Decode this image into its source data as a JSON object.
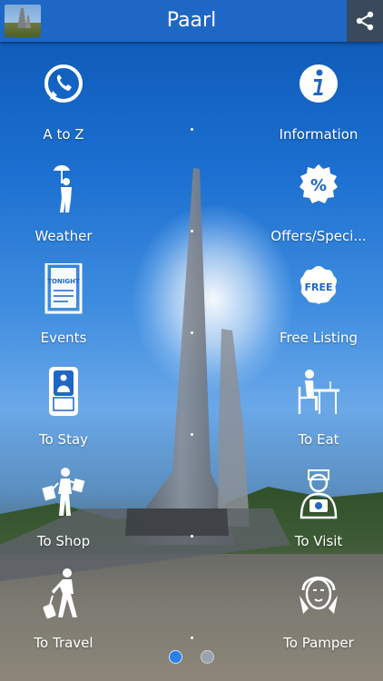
{
  "header": {
    "title": "Paarl"
  },
  "tiles": [
    {
      "label": "A to Z"
    },
    {
      "label": "Information"
    },
    {
      "label": "Weather"
    },
    {
      "label": "Offers/Speci..."
    },
    {
      "label": "Events"
    },
    {
      "label": "Free Listing"
    },
    {
      "label": "To Stay"
    },
    {
      "label": "To Eat"
    },
    {
      "label": "To Shop"
    },
    {
      "label": "To Visit"
    },
    {
      "label": "To Travel"
    },
    {
      "label": "To Pamper"
    }
  ],
  "icons": {
    "a_to_z": "whatsapp-icon",
    "information": "info-icon",
    "weather": "umbrella-person-icon",
    "offers": "percent-badge-icon",
    "events": "ticket-poster-icon",
    "free_listing": "free-badge-icon",
    "to_stay": "hotel-door-icon",
    "to_eat": "dining-person-icon",
    "to_shop": "shopping-person-icon",
    "to_visit": "camera-person-icon",
    "to_travel": "luggage-traveler-icon",
    "to_pamper": "spa-face-icon",
    "share": "share-icon"
  },
  "badges": {
    "offers": "%",
    "free": "FREE",
    "events_poster": "TONIGHT"
  },
  "pager": {
    "pages": 2,
    "active": 1
  },
  "colors": {
    "header": "#1e67c4",
    "share_bg": "#3a4a5c",
    "pager_active": "#2a80e6",
    "pager_inactive": "#9aa3ab"
  }
}
